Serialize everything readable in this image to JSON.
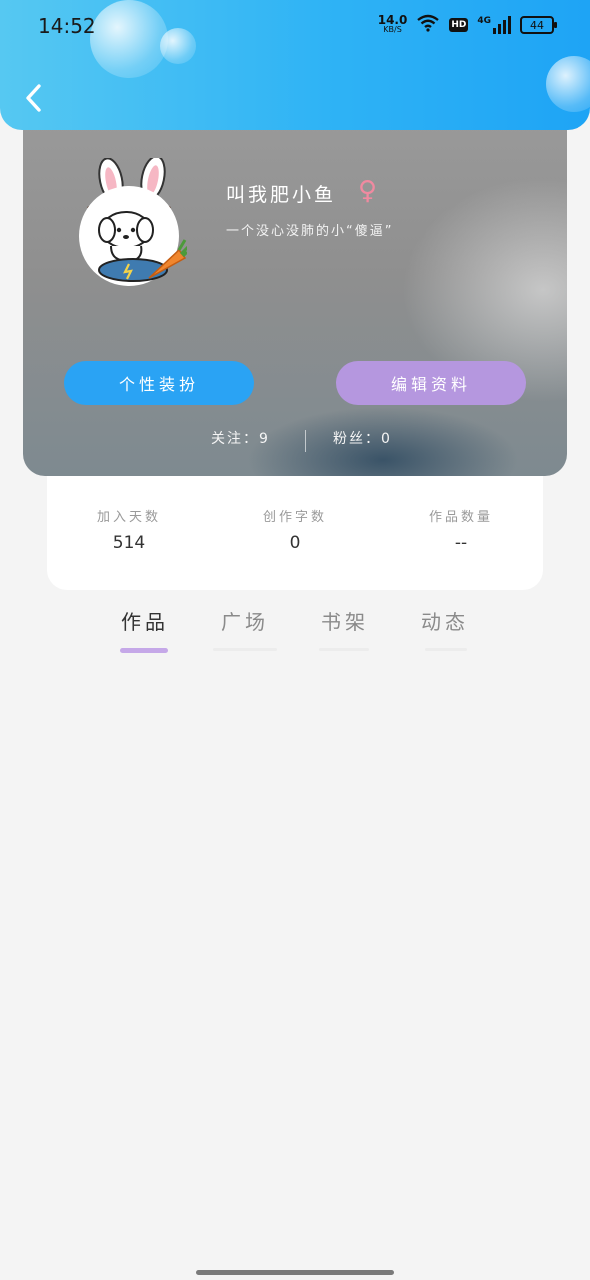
{
  "status_bar": {
    "time": "14:52",
    "net_speed_value": "14.0",
    "net_speed_unit": "KB/S",
    "hd_label": "HD",
    "network_label": "4G",
    "battery": "44"
  },
  "profile": {
    "nickname": "叫我肥小鱼",
    "gender_symbol": "♀",
    "signature": "一个没心没肺的小“傻逼”",
    "dress_up_button": "个性装扮",
    "edit_profile_button": "编辑资料",
    "following": "关注：9",
    "followers": "粉丝：0"
  },
  "stats": [
    {
      "label": "加入天数",
      "value": "514"
    },
    {
      "label": "创作字数",
      "value": "0"
    },
    {
      "label": "作品数量",
      "value": "--"
    }
  ],
  "tabs": [
    {
      "label": "作品",
      "active": true
    },
    {
      "label": "广场",
      "active": false
    },
    {
      "label": "书架",
      "active": false
    },
    {
      "label": "动态",
      "active": false
    }
  ],
  "colors": {
    "header_blue": "#2fb3f5",
    "dress_up_blue": "#2aa3f4",
    "edit_purple": "#b597df",
    "tab_indicator": "#c5a8e8"
  }
}
